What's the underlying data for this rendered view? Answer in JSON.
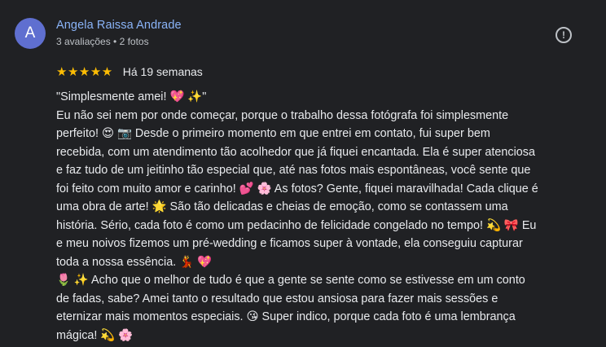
{
  "author": {
    "initial": "A",
    "name": "Angela Raissa Andrade",
    "meta": "3 avaliações • 2 fotos",
    "avatar_color": "#5f6fd0"
  },
  "report": {
    "icon": "report-flag-icon",
    "glyph": "!"
  },
  "rating": {
    "stars": "★★★★★",
    "value": 5,
    "max": 5,
    "star_color": "#fbbc04"
  },
  "date": "Há 19 semanas",
  "review_lines": [
    "\"Simplesmente amei! 💖 ✨\"",
    "Eu não sei nem por onde começar, porque o trabalho dessa fotógrafa foi simplesmente",
    "perfeito! 😍 📷  Desde o primeiro momento em que entrei em contato, fui super bem",
    "recebida, com um atendimento tão acolhedor que já fiquei encantada. Ela é super atenciosa",
    "e faz tudo de um jeitinho tão especial que, até nas fotos mais espontâneas, você sente que",
    "foi feito com muito amor e carinho! 💕 🌸 As fotos? Gente, fiquei maravilhada! Cada clique é",
    "uma obra de arte! 🌟  São tão delicadas e cheias de emoção, como se contassem uma",
    "história. Sério, cada foto é como um pedacinho de felicidade congelado no tempo! 💫 🎀  Eu",
    "e meu noivos fizemos um pré-wedding e ficamos super à vontade, ela conseguiu capturar",
    "toda a nossa essência. 💃 💖",
    "🌷 ✨  Acho que o melhor de tudo é que a gente se sente como se estivesse em um conto",
    "de fadas, sabe? Amei tanto o resultado que estou ansiosa para fazer mais sessões e",
    "eternizar mais momentos especiais. 😘  Super indico, porque cada foto é uma lembrança",
    "mágica! 💫 🌸"
  ]
}
